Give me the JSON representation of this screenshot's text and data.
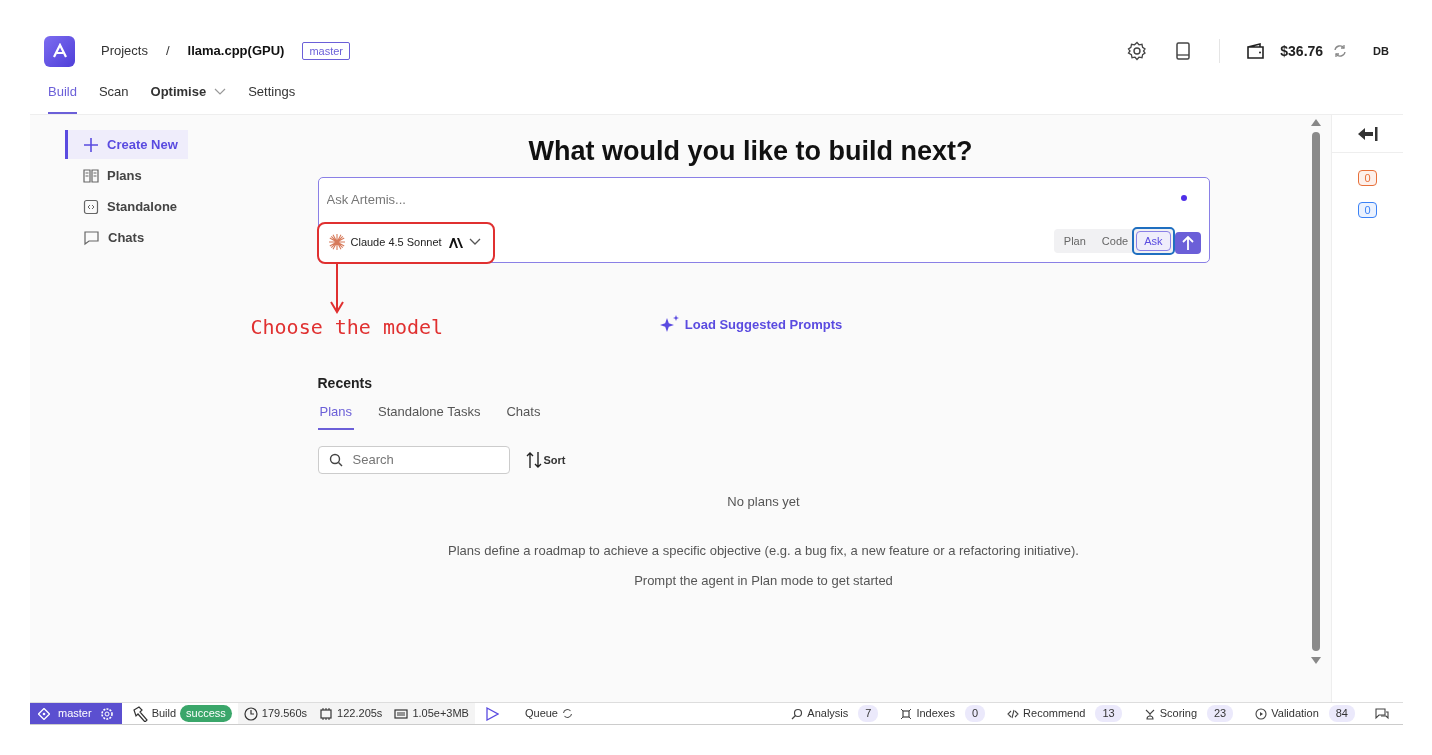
{
  "header": {
    "breadcrumb": [
      {
        "label": "Projects"
      },
      {
        "label": "llama.cpp(GPU)"
      }
    ],
    "separator": "/",
    "branch": "master",
    "balance": "$36.76",
    "user_initials": "DB"
  },
  "tabs": [
    {
      "label": "Build",
      "selected": true,
      "dropdown": false
    },
    {
      "label": "Scan",
      "selected": false,
      "dropdown": false
    },
    {
      "label": "Optimise",
      "selected": false,
      "dropdown": true
    },
    {
      "label": "Settings",
      "selected": false,
      "dropdown": false
    }
  ],
  "sidebar": {
    "items": [
      {
        "label": "Create New",
        "kind": "plus",
        "selected": true
      },
      {
        "label": "Plans",
        "kind": "book",
        "selected": false
      },
      {
        "label": "Standalone",
        "kind": "code",
        "selected": false
      },
      {
        "label": "Chats",
        "kind": "chat",
        "selected": false
      }
    ]
  },
  "heading": "What would you like to build next?",
  "prompt": {
    "placeholder": "Ask Artemis...",
    "model": "Claude 4.5 Sonnet",
    "modes": [
      {
        "label": "Plan",
        "selected": false
      },
      {
        "label": "Code",
        "selected": false
      },
      {
        "label": "Ask",
        "selected": true
      }
    ]
  },
  "suggest": "Load Suggested Prompts",
  "recents": {
    "title": "Recents",
    "tabs": [
      {
        "label": "Plans",
        "selected": true
      },
      {
        "label": "Standalone Tasks",
        "selected": false
      },
      {
        "label": "Chats",
        "selected": false
      }
    ],
    "search_placeholder": "Search",
    "sort": "Sort",
    "empty_title": "No plans yet",
    "empty_lines": [
      "Plans define a roadmap to achieve a specific objective (e.g. a bug fix, a new feature or a refactoring initiative).",
      "Prompt the agent in Plan mode to get started"
    ]
  },
  "right_panel": {
    "counters": [
      {
        "value": "0",
        "color": "#e8703a"
      },
      {
        "value": "0",
        "color": "#3b82f6"
      }
    ]
  },
  "status_bar": {
    "branch": "master",
    "build_label": "Build",
    "build_status": "success",
    "timings": [
      {
        "kind": "clock",
        "value": "179.560s"
      },
      {
        "kind": "chip",
        "value": "122.205s"
      },
      {
        "kind": "memory",
        "value": "1.05e+3MB"
      }
    ],
    "queue": "Queue",
    "metrics": [
      {
        "kind": "search",
        "label": "Analysis",
        "count": "7"
      },
      {
        "kind": "index",
        "label": "Indexes",
        "count": "0"
      },
      {
        "kind": "code",
        "label": "Recommend",
        "count": "13"
      },
      {
        "kind": "score",
        "label": "Scoring",
        "count": "23"
      },
      {
        "kind": "play",
        "label": "Validation",
        "count": "84"
      }
    ]
  },
  "annotations": [
    {
      "text": "Choose the model"
    }
  ]
}
